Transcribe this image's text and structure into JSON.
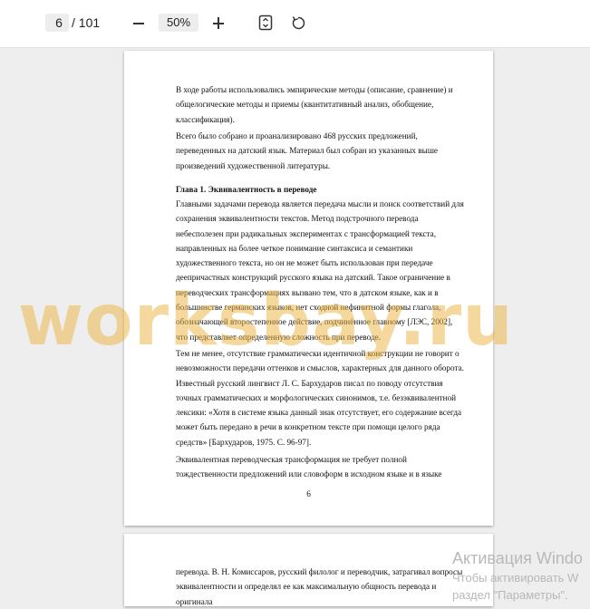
{
  "toolbar": {
    "current_page": "6",
    "total_pages": "/ 101",
    "zoom": "50%",
    "icons": {
      "zoom_out": "minus-icon",
      "zoom_in": "plus-icon",
      "fit": "fit-page-icon",
      "rotate": "rotate-icon"
    }
  },
  "page1": {
    "paragraphs": [
      "В ходе работы использовались эмпирические методы (описание, сравнение) и общелогические методы и приемы (квантитативный анализ, обобщение, классификация).",
      "Всего было собрано и проанализировано 468 русских предложений, переведенных на датский язык. Материал был собран из указанных выше произведений художественной литературы."
    ],
    "heading": "Глава 1. Эквивалентность в переводе",
    "body": [
      "Главными задачами перевода является передача мысли и поиск соответствий для сохранения эквивалентности текстов. Метод подстрочного перевода небесполезен при радикальных экспериментах с трансформацией текста, направленных на более четкое понимание синтаксиса и семантики художественного текста, но он не может быть использован при передаче деепричастных конструкций русского языка на датский. Такое ограничение в переводческих трансформациях вызвано тем, что в датском языке, как и в большинстве германских языков, нет сходной нефинитной формы глагола, обозначающей второстепенное действие, подчинённое главному [ЛЭС, 2002], что представляет определенную сложность при переводе.",
      "Тем не менее, отсутствие грамматически идентичной конструкции не говорит о невозможности передачи оттенков и смыслов, характерных для данного оборота. Известный русский лингвист Л. С. Бархударов писал по поводу отсутствия точных грамматических и морфологических синонимов, т.е. безэквивалентной лексики: «Хотя в системе языка данный знак отсутствует, его содержание всегда может быть передано в речи в конкретном тексте при помощи целого ряда средств» [Бархударов, 1975. С. 96-97].",
      "Эквивалентная переводческая трансформация не требует полной тождественности предложений или словоформ в исходном языке и в языке"
    ],
    "page_number": "6"
  },
  "page2": {
    "text": "перевода. В. Н. Комиссаров, русский филолог и переводчик, затрагивал вопросы эквивалентности и определял ее как максимальную общность перевода и оригинала"
  },
  "watermark": {
    "text": "worksbay.ru",
    "color": "#ecb23e"
  },
  "activation": {
    "title": "Активация Windo",
    "line1": "Чтобы активировать W",
    "line2": "раздел \"Параметры\"."
  }
}
